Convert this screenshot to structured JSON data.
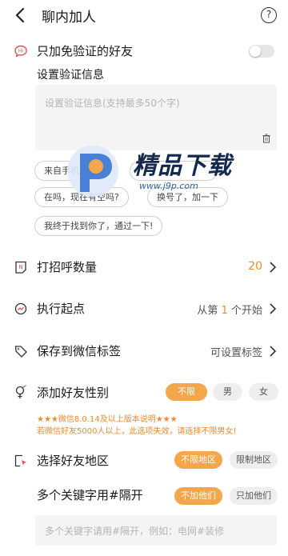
{
  "header": {
    "title": "聊内加人",
    "help_symbol": "?"
  },
  "verify_only": {
    "label": "只加免验证的好友",
    "enabled": false
  },
  "verify_message": {
    "label": "设置验证信息",
    "placeholder": "设置验证信息(支持最多50个字)",
    "presets": [
      "来自手机通讯录",
      "在吗，现在有空吗?",
      "换号了，加一下",
      "我终于找到你了，通过一下!"
    ]
  },
  "greeting_count": {
    "label": "打招呼数量",
    "value": "20"
  },
  "start_point": {
    "label": "执行起点",
    "prefix": "从第",
    "number": "1",
    "suffix": "个开始"
  },
  "save_tag": {
    "label": "保存到微信标签",
    "value": "可设置标签"
  },
  "gender": {
    "label": "添加好友性别",
    "options": [
      "不限",
      "男",
      "女"
    ],
    "selected": "不限",
    "note_line1": "★★★微信8.0.14及以上版本说明★★★",
    "note_line2": "若微信好友5000人以上，此选项失效，请选择不限男女!"
  },
  "region": {
    "label": "选择好友地区",
    "options": [
      "不限地区",
      "限制地区"
    ],
    "selected": "不限地区"
  },
  "keywords": {
    "label": "多个关键字用#隔开",
    "options": [
      "不加他们",
      "只加他们"
    ],
    "selected": "不加他们",
    "placeholder": "多个关键字请用#隔开，例如：电网#装修"
  },
  "watermark": {
    "brand": "精品下载",
    "url": "www.j9p.com"
  },
  "colors": {
    "accent": "#f3a64a",
    "note": "#f08a2c",
    "icon_red": "#d9534f"
  },
  "icons": [
    "chevron-left-icon",
    "help-circle-icon",
    "chat-badge-icon",
    "trash-icon",
    "note-n-icon",
    "refresh-icon",
    "tag-icon",
    "gender-icon",
    "location-cursor-icon",
    "chevron-right-icon"
  ]
}
